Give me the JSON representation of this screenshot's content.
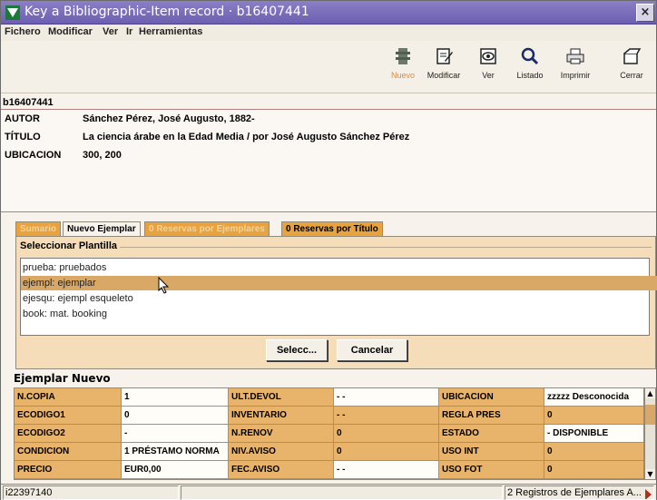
{
  "window": {
    "title": "Key a Bibliographic-Item record · b16407441",
    "close_label": "×"
  },
  "menu": [
    {
      "label": "Fichero"
    },
    {
      "label": "Modificar"
    },
    {
      "label": "Ver"
    },
    {
      "label": "Ir"
    },
    {
      "label": "Herramientas"
    }
  ],
  "toolbar": {
    "buttons": [
      {
        "label": "Nuevo",
        "icon": "new-record-icon",
        "enabled": false
      },
      {
        "label": "Modificar",
        "icon": "edit-icon",
        "enabled": true
      },
      {
        "label": "Ver",
        "icon": "view-icon",
        "enabled": true
      },
      {
        "label": "Listado",
        "icon": "search-icon",
        "enabled": true
      },
      {
        "label": "Imprimir",
        "icon": "printer-icon",
        "enabled": true
      },
      {
        "label": "Cerrar",
        "icon": "close-doc-icon",
        "enabled": true
      }
    ]
  },
  "record": {
    "id": "b16407441",
    "fields": [
      {
        "label": "AUTOR",
        "value": "Sánchez Pérez, José Augusto, 1882-"
      },
      {
        "label": "TÍTULO",
        "value": "La ciencia árabe en la Edad Media / por José Augusto Sánchez Pérez"
      },
      {
        "label": "UBICACION",
        "value": "300, 200"
      }
    ]
  },
  "tabs": [
    {
      "label": "Sumario",
      "state": "disabled"
    },
    {
      "label": "Nuevo Ejemplar",
      "state": "active"
    },
    {
      "label": "0 Reservas por Ejemplares",
      "state": "disabled"
    },
    {
      "label": "0 Reservas por Título",
      "state": "other"
    }
  ],
  "plantilla": {
    "group_label": "Seleccionar Plantilla",
    "items": [
      {
        "label": "prueba: pruebados",
        "selected": false
      },
      {
        "label": "ejempl: ejemplar",
        "selected": true
      },
      {
        "label": "ejesqu: ejempl esqueleto",
        "selected": false
      },
      {
        "label": "book: mat. booking",
        "selected": false
      }
    ],
    "select_button": "Selecc...",
    "cancel_button": "Cancelar"
  },
  "ejemplar": {
    "title": "Ejemplar Nuevo",
    "rows": [
      [
        "N.COPIA",
        "1",
        "ULT.DEVOL",
        "- -",
        "UBICACION",
        "zzzzz Desconocida"
      ],
      [
        "ECODIGO1",
        "0",
        "INVENTARIO",
        "- -",
        "REGLA PRES",
        "0"
      ],
      [
        "ECODIGO2",
        "-",
        "N.RENOV",
        "0",
        "ESTADO",
        "- DISPONIBLE"
      ],
      [
        "CONDICION",
        "1 PRÉSTAMO NORMA",
        "NIV.AVISO",
        "0",
        "USO INT",
        "0"
      ],
      [
        "PRECIO",
        "EUR0,00",
        "FEC.AVISO",
        "- -",
        "USO FOT",
        "0"
      ]
    ]
  },
  "status": {
    "left": "i22397140",
    "middle": "",
    "right": "2 Registros de Ejemplares A..."
  },
  "colors": {
    "titlebar": "#6c5fb0",
    "tab_orange": "#e8a33f",
    "selected_row": "#d9a867",
    "panel": "#f4ddb8"
  }
}
